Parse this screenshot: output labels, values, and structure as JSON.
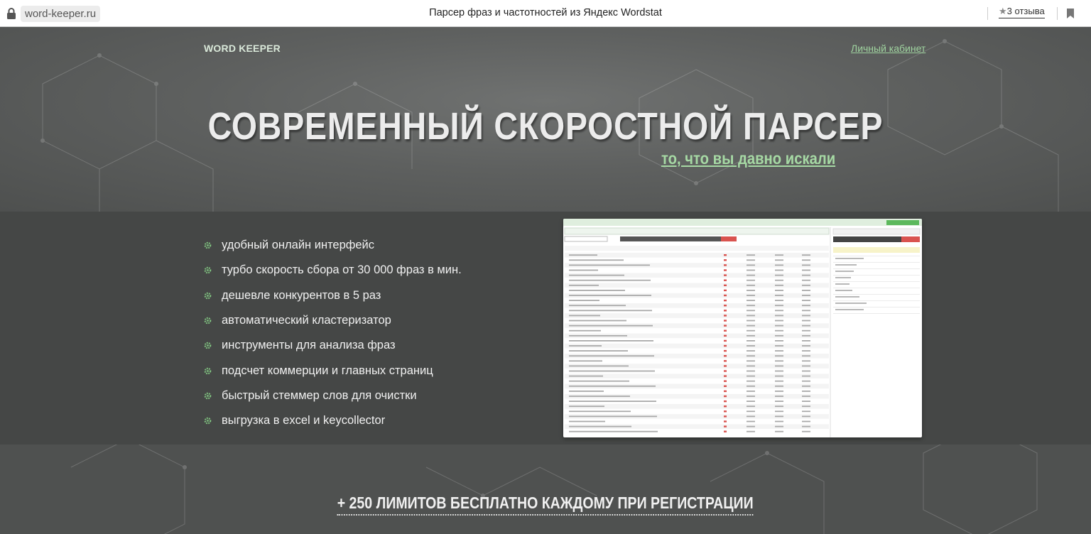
{
  "browser": {
    "url": "word-keeper.ru",
    "title": "Парсер фраз и частотностей из Яндекс Wordstat",
    "reviews": "3 отзыва",
    "reviews_icon": "star-icon"
  },
  "header": {
    "logo": "WORD KEEPER",
    "account_link": "Личный кабинет"
  },
  "hero": {
    "headline": "СОВРЕМЕННЫЙ СКОРОСТНОЙ ПАРСЕР",
    "subheadline": "то, что вы давно искали"
  },
  "features": [
    "удобный онлайн интерфейс",
    "турбо скорость сбора от 30 000 фраз в мин.",
    "дешевле конкурентов в 5 раз",
    "автоматический кластеризатор",
    "инструменты для анализа фраз",
    "подсчет коммерции и главных страниц",
    "быстрый стеммер слов для очистки",
    "выгрузка в excel и keycollector"
  ],
  "cta": "+ 250 ЛИМИТОВ БЕСПЛАТНО КАЖДОМУ ПРИ РЕГИСТРАЦИИ",
  "colors": {
    "accent": "#a6d9a4",
    "background": "#4f5150",
    "band": "#454746"
  }
}
